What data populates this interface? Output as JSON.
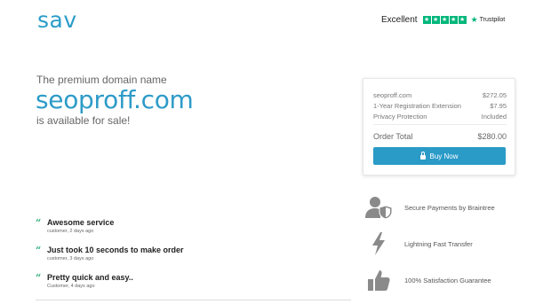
{
  "header": {
    "logo": "sav",
    "trustpilot": {
      "label": "Excellent",
      "rating_stars": 5,
      "brand": "Trustpilot",
      "brand_color": "#00b67a"
    }
  },
  "hero": {
    "pre_text": "The premium domain name",
    "domain": "seoproff.com",
    "post_text": "is available for sale!"
  },
  "pricing": {
    "lines": [
      {
        "label": "seoproff.com",
        "value": "$272.05"
      },
      {
        "label": "1-Year Registration Extension",
        "value": "$7.95"
      },
      {
        "label": "Privacy Protection",
        "value": "Included"
      }
    ],
    "total_label": "Order Total",
    "total_value": "$280.00",
    "buy_label": "Buy Now",
    "accent_color": "#2a9ac7"
  },
  "features": [
    {
      "icon": "user-shield-icon",
      "text": "Secure Payments by Braintree"
    },
    {
      "icon": "lightning-icon",
      "text": "Lightning Fast Transfer"
    },
    {
      "icon": "thumbs-up-icon",
      "text": "100% Satisfaction Guarantee"
    }
  ],
  "reviews": [
    {
      "title": "Awesome service",
      "meta": "customer, 2 days ago"
    },
    {
      "title": "Just took 10 seconds to make order",
      "meta": "customer, 3 days ago"
    },
    {
      "title": "Pretty quick and easy..",
      "meta": "Customer, 4 days ago"
    }
  ]
}
